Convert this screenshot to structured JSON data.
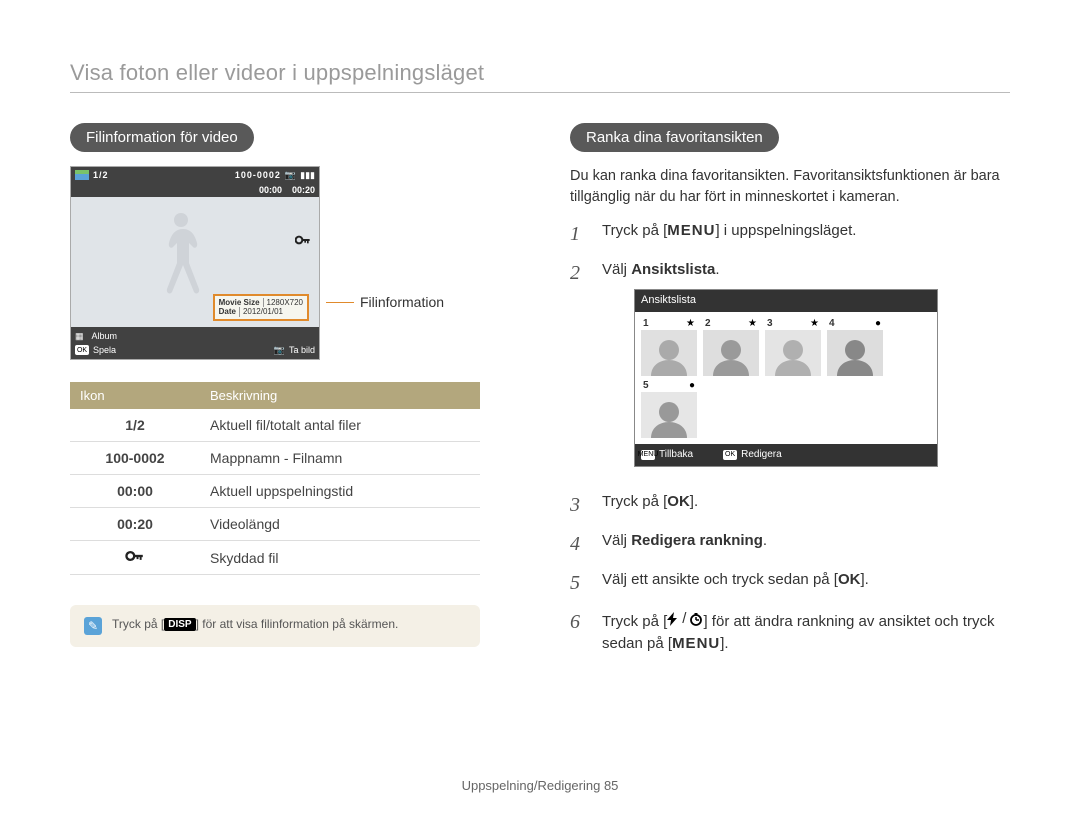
{
  "page": {
    "title": "Visa foton eller videor i uppspelningsläget",
    "footer": "Uppspelning/Redigering  85"
  },
  "left": {
    "pill": "Filinformation för video",
    "screen": {
      "top_counter": "1/2",
      "top_folder": "100-0002",
      "time_elapsed": "00:00",
      "time_total": "00:20",
      "popup_size_key": "Movie Size",
      "popup_size_val": "1280X720",
      "popup_date_key": "Date",
      "popup_date_val": "2012/01/01",
      "album_label": "Album",
      "ok_label": "OK",
      "play_label": "Spela",
      "capture_label": "Ta bild"
    },
    "callout": "Filinformation",
    "table_head_icon": "Ikon",
    "table_head_desc": "Beskrivning",
    "rows": [
      {
        "icon": "1/2",
        "desc": "Aktuell fil/totalt antal filer"
      },
      {
        "icon": "100-0002",
        "desc": "Mappnamn - Filnamn"
      },
      {
        "icon": "00:00",
        "desc": "Aktuell uppspelningstid"
      },
      {
        "icon": "00:20",
        "desc": "Videolängd"
      },
      {
        "icon": "🔒",
        "desc": "Skyddad fil",
        "is_key": true
      }
    ],
    "tip_prefix": "Tryck på [",
    "tip_badge": "DISP",
    "tip_suffix": "] för att visa filinformation på skärmen."
  },
  "right": {
    "pill": "Ranka dina favoritansikten",
    "intro": "Du kan ranka dina favoritansikten. Favoritansiktsfunktionen är bara tillgänglig när du har fört in minneskortet i kameran.",
    "step1_pre": "Tryck på [",
    "menu_badge": "MENU",
    "step1_post": "] i uppspelningsläget.",
    "step2_pre": "Välj ",
    "step2_bold": "Ansiktslista",
    "step2_post": ".",
    "face_panel": {
      "title": "Ansiktslista",
      "back_badge": "MENU",
      "back_label": "Tillbaka",
      "ok_badge": "OK",
      "edit_label": "Redigera",
      "faces": [
        1,
        2,
        3,
        4,
        5
      ]
    },
    "step3_pre": "Tryck på [",
    "ok_badge": "OK",
    "step3_post": "].",
    "step4_pre": "Välj ",
    "step4_bold": "Redigera rankning",
    "step4_post": ".",
    "step5_pre": "Välj ett ansikte och tryck sedan på [",
    "step5_post": "].",
    "step6_pre": "Tryck på [",
    "step6_mid1": "/",
    "step6_mid2": "] för att ändra rankning av ansiktet och tryck sedan på [",
    "step6_post": "]."
  }
}
